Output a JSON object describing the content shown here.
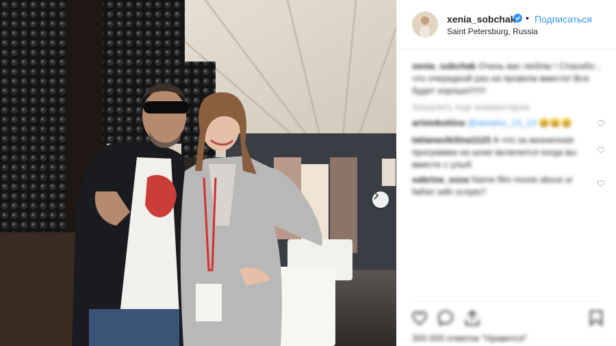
{
  "post": {
    "username": "xenia_sobchak",
    "follow_label": "Подписаться",
    "location": "Saint Petersburg, Russia",
    "verified": true,
    "dot": "•"
  },
  "caption": {
    "author": "xenia_sobchak",
    "text": "Очень вас люблю ! Спасибо , что очередной раз на провели вместе! Все будет хорошо!!!!!!!"
  },
  "load_more_label": "Загрузить еще комментарии",
  "comments": [
    {
      "author": "aristokotiina",
      "mention": "@wesdoc_13_13",
      "text": "😄😄😄"
    },
    {
      "author": "tatianavikitina1123",
      "mention": "",
      "text": "А что за жизненная программа на шоке включится когда вы вместе с улыб"
    },
    {
      "author": "sabrina_sosa",
      "mention": "",
      "text": "Name film movie about ur father with scripts?"
    }
  ],
  "likes_text": "300 000 отметок \"Нравится\"",
  "icons": {
    "next": "chevron-right-icon",
    "like": "heart-icon",
    "comment": "speech-bubble-icon",
    "share": "share-icon",
    "save": "bookmark-icon",
    "verified": "verified-badge-icon"
  },
  "colors": {
    "link": "#3897f0",
    "text": "#262626",
    "muted": "#999999",
    "border": "#efefef"
  }
}
